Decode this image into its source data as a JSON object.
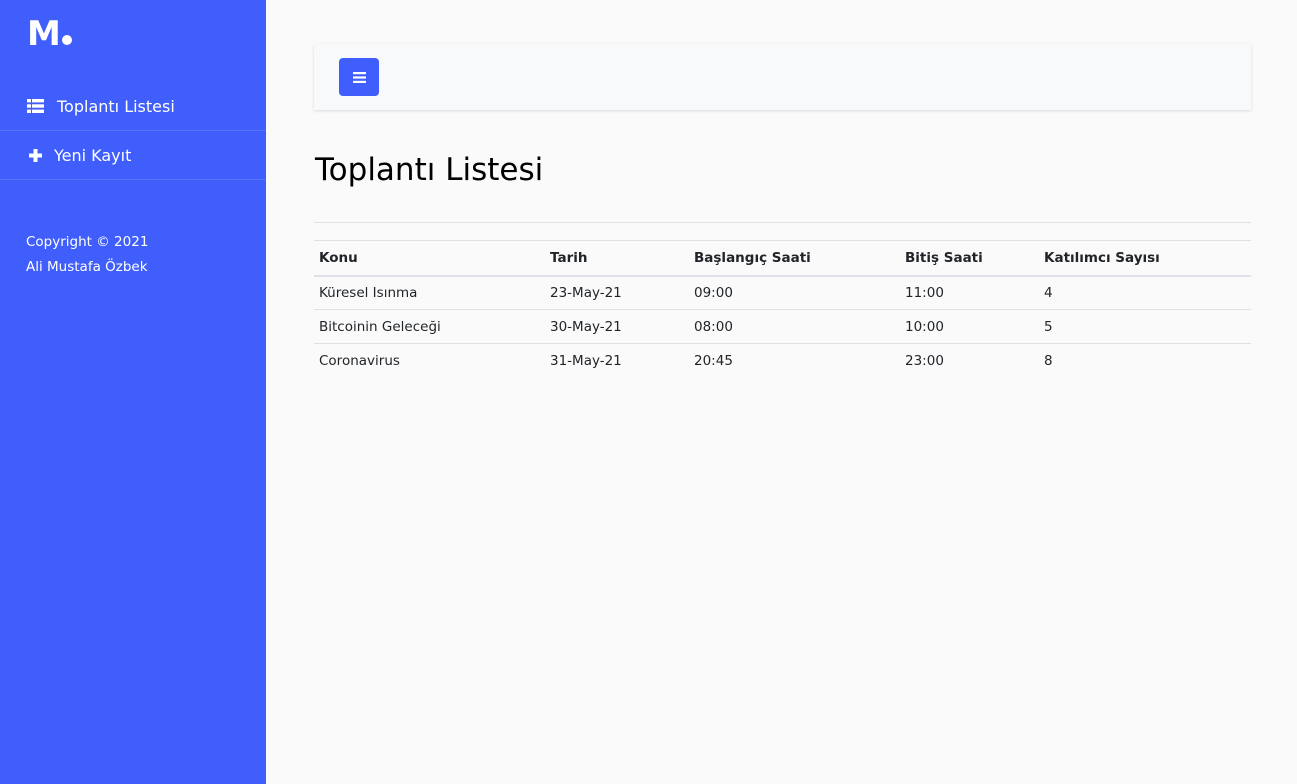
{
  "brand": {
    "logo_text": "M"
  },
  "sidebar": {
    "items": [
      {
        "label": "Toplantı Listesi",
        "icon": "list-icon"
      },
      {
        "label": "Yeni Kayıt",
        "icon": "plus-icon"
      }
    ],
    "footer": {
      "copyright": "Copyright © 2021",
      "author": "Ali Mustafa Özbek"
    }
  },
  "topbar": {
    "menu_icon": "hamburger-icon"
  },
  "main": {
    "title": "Toplantı Listesi",
    "table": {
      "headers": [
        "Konu",
        "Tarih",
        "Başlangıç Saati",
        "Bitiş Saati",
        "Katılımcı Sayısı"
      ],
      "rows": [
        [
          "Küresel Isınma",
          "23-May-21",
          "09:00",
          "11:00",
          "4"
        ],
        [
          "Bitcoinin Geleceği",
          "30-May-21",
          "08:00",
          "10:00",
          "5"
        ],
        [
          "Coronavirus",
          "31-May-21",
          "20:45",
          "23:00",
          "8"
        ]
      ]
    }
  },
  "colors": {
    "accent": "#3f5efb",
    "background": "#fafafa",
    "text": "#212529"
  }
}
